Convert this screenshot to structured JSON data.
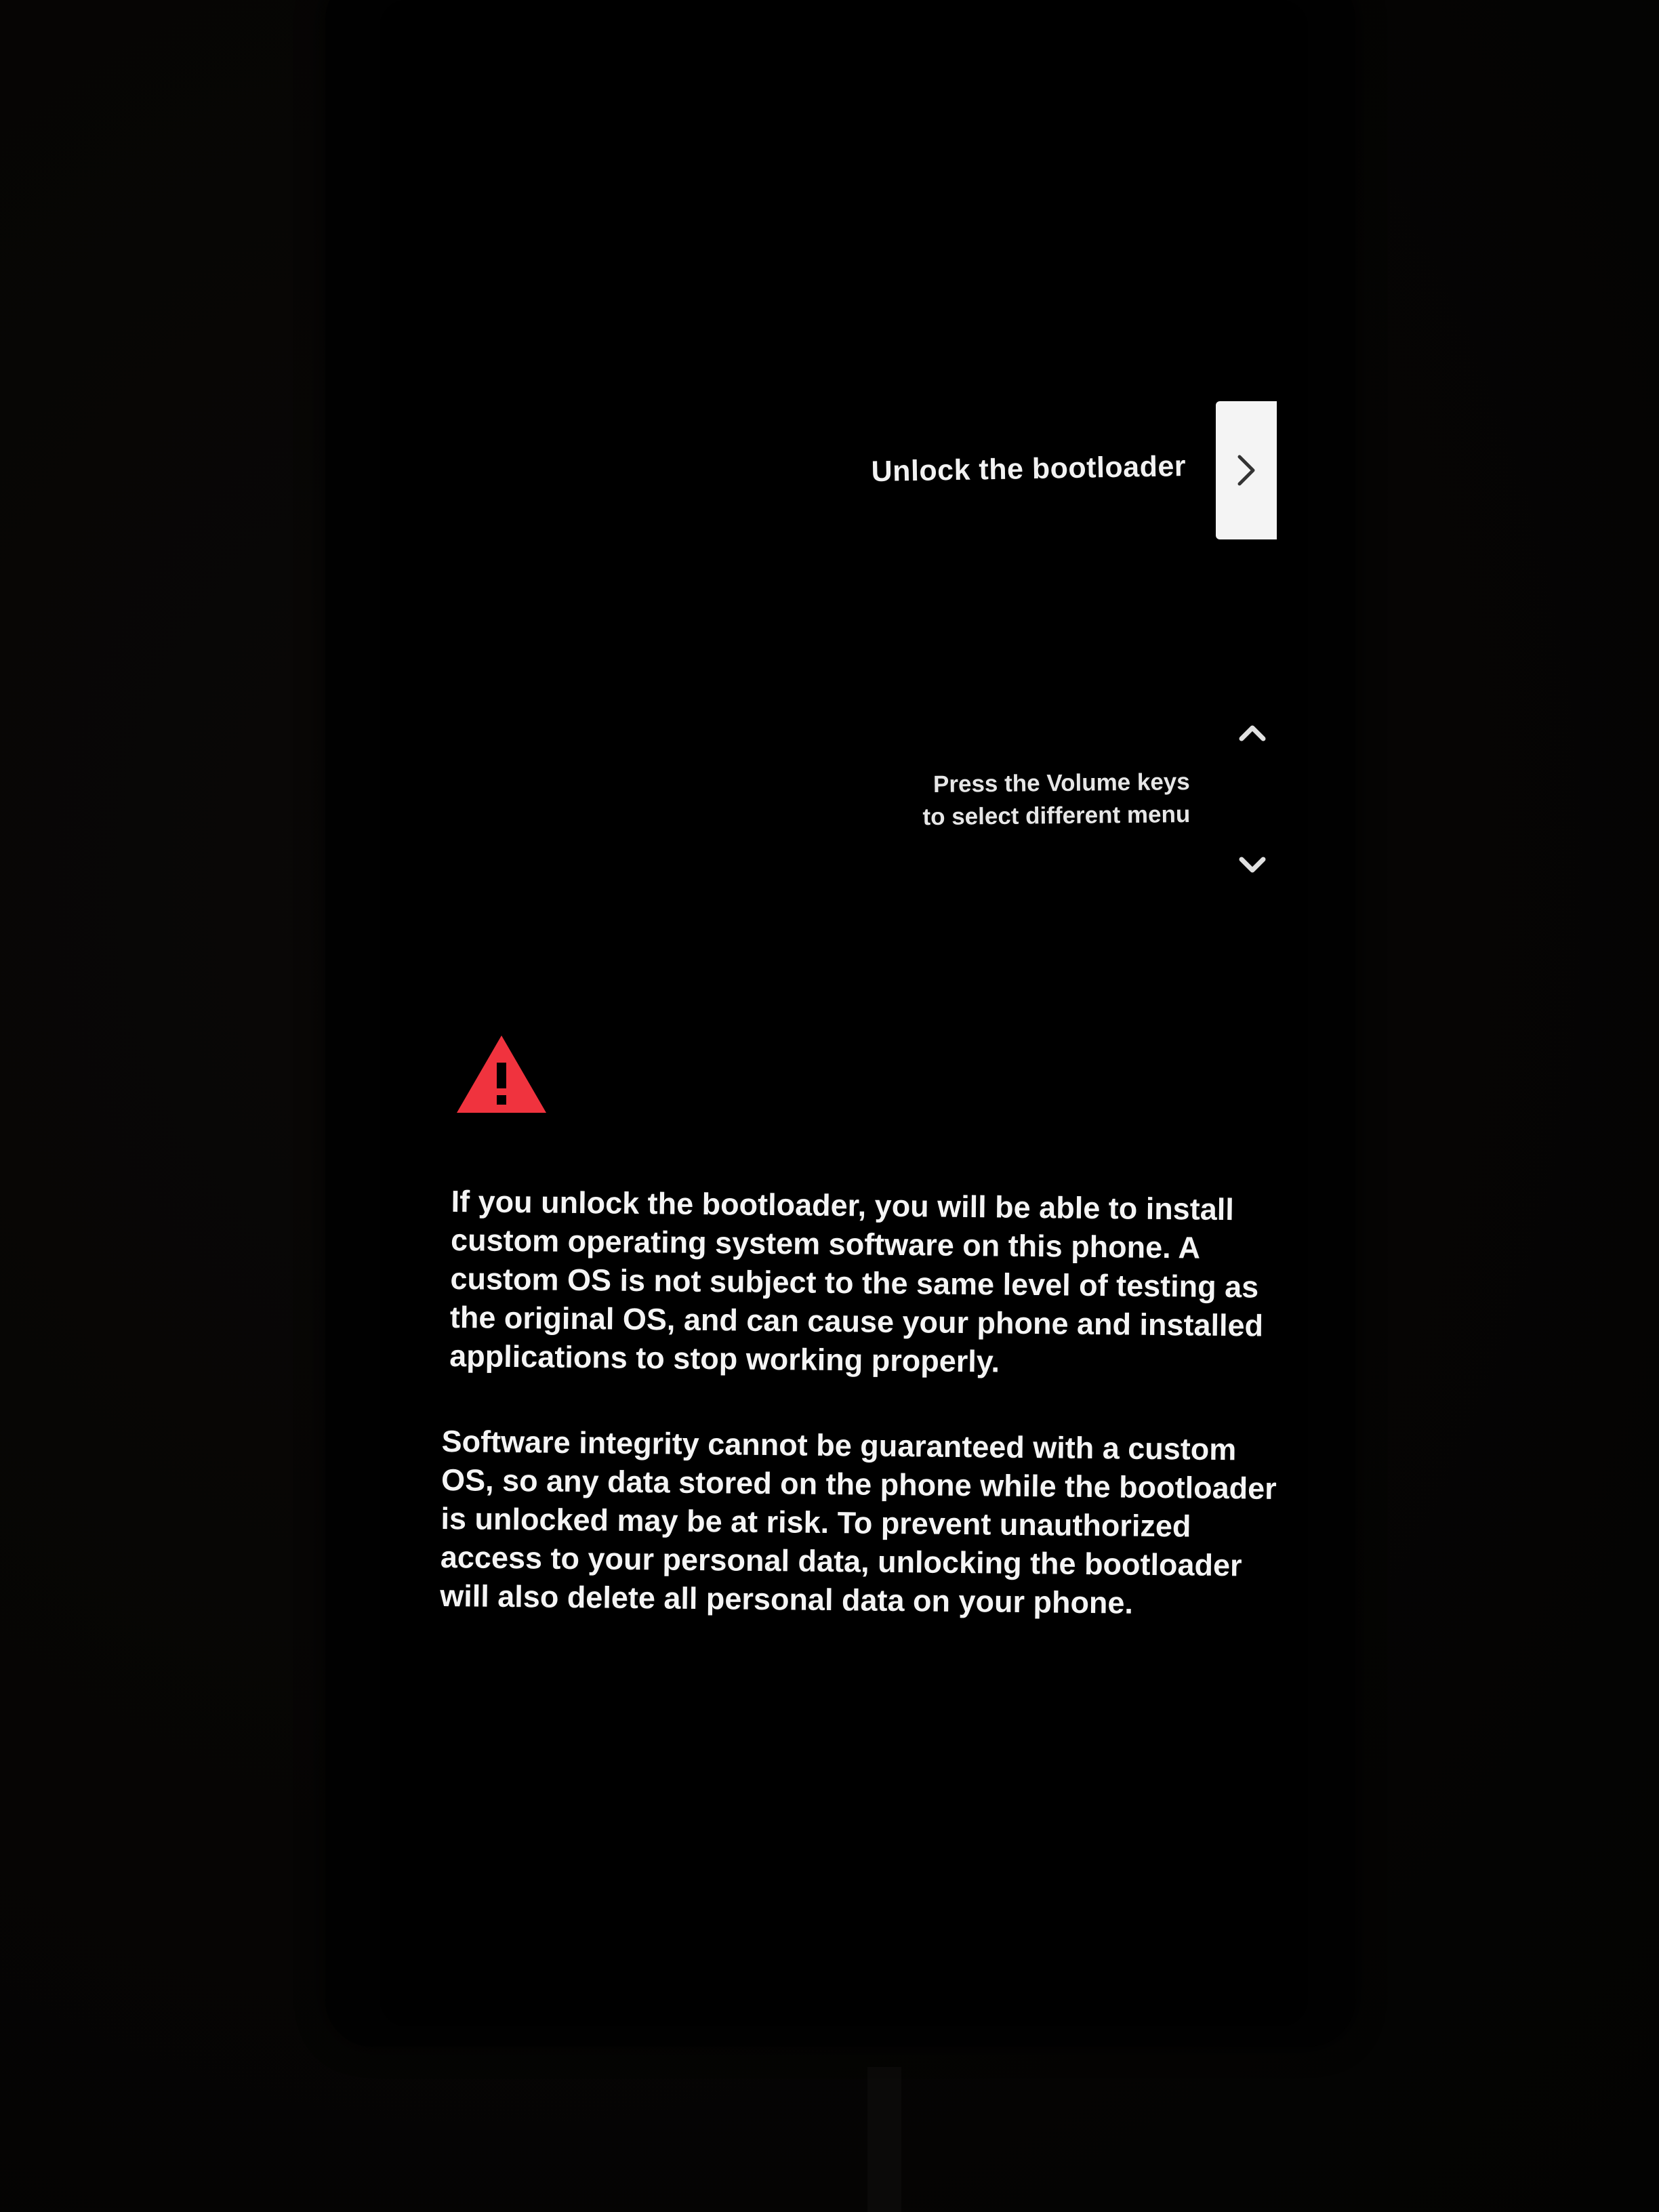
{
  "menu": {
    "selected_label": "Unlock the bootloader",
    "next_icon": "chevron-right-icon"
  },
  "navigation": {
    "up_icon": "chevron-up-icon",
    "down_icon": "chevron-down-icon",
    "hint_lines": [
      "Press the Volume keys",
      "to select different menu"
    ]
  },
  "warning": {
    "icon": "warning-triangle-icon",
    "icon_color": "#f0333e",
    "paragraph_1_lines": [
      "If you unlock the bootloader, you will be able to install",
      "custom operating system software on this phone. A",
      "custom OS is not subject to the same level of testing as",
      "the original OS, and can cause your phone and installed",
      "applications to stop working properly."
    ],
    "paragraph_2_lines": [
      "Software integrity cannot be guaranteed with a custom",
      "OS, so any data stored on the phone while the bootloader",
      "is unlocked may be at risk. To prevent unauthorized",
      "access to your personal data, unlocking the bootloader",
      "will also delete all personal data on your phone."
    ]
  }
}
